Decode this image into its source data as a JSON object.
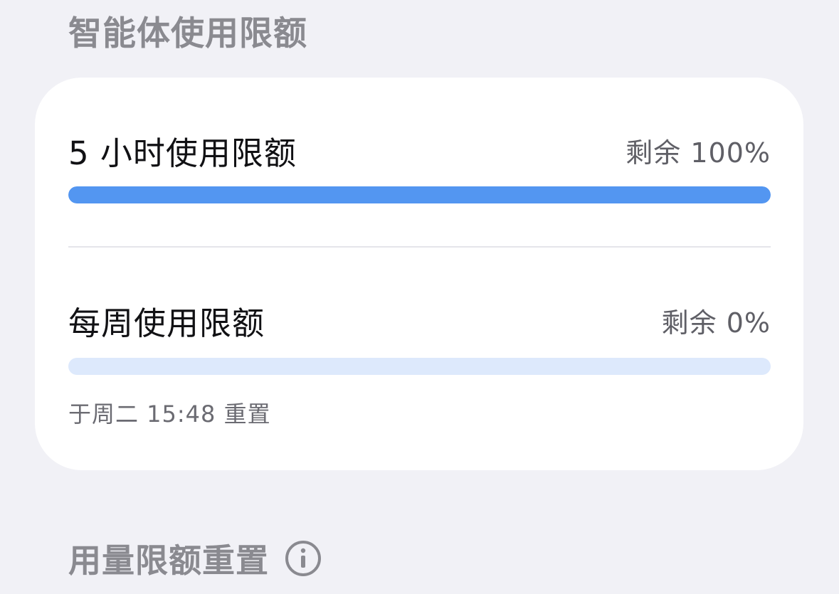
{
  "sections": {
    "agent_limits_title": "智能体使用限额",
    "reset_title": "用量限额重置"
  },
  "limits": [
    {
      "title": "5 小时使用限额",
      "remaining_text": "剩余 100%",
      "remaining_fraction": 1.0
    },
    {
      "title": "每周使用限额",
      "remaining_text": "剩余 0%",
      "remaining_fraction": 0.0,
      "reset_note": "于周二 15:48 重置"
    }
  ],
  "colors": {
    "background": "#f1f1f6",
    "card": "#ffffff",
    "bar_fill": "#5396f1",
    "bar_track": "#dde9fc"
  },
  "icons": {
    "reset_info": "info-circle-icon"
  }
}
